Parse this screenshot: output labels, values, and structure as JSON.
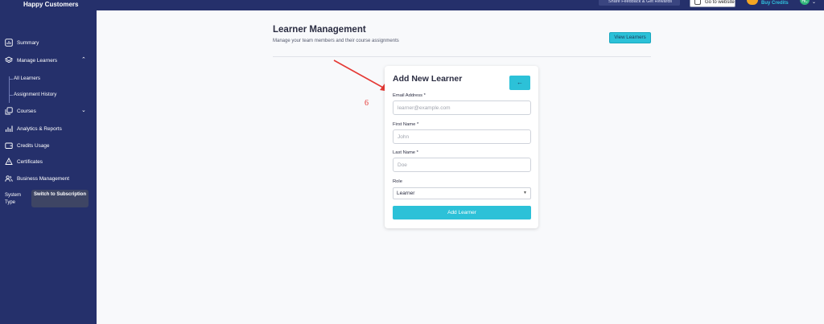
{
  "topbar": {
    "brand": "Happy Customers",
    "feedback_label": "Share Feedback & Get Rewards",
    "website_label": "Go to website",
    "buy_credits_label": "Buy Credits",
    "avatar_initials": "HC"
  },
  "sidebar": {
    "items": [
      {
        "label": "Summary",
        "icon": "chart-square-icon"
      },
      {
        "label": "Manage Learners",
        "icon": "layers-icon",
        "chevron": "⌃"
      },
      {
        "label": "All Learners"
      },
      {
        "label": "Assignment History"
      },
      {
        "label": "Courses",
        "icon": "book-copy-icon",
        "chevron": "⌄"
      },
      {
        "label": "Analytics & Reports",
        "icon": "bar-chart-icon"
      },
      {
        "label": "Credits Usage",
        "icon": "wallet-icon"
      },
      {
        "label": "Certificates",
        "icon": "certificate-icon"
      },
      {
        "label": "Business Management",
        "icon": "users-icon"
      }
    ],
    "system_type_label": "System Type",
    "switch_label": "Switch to Subscription"
  },
  "header": {
    "title": "Learner Management",
    "subtitle": "Manage your team members and their course assignments",
    "view_learners_label": "View Learners"
  },
  "annotation": {
    "step": "6",
    "color": "#e53935"
  },
  "form": {
    "title": "Add New Learner",
    "back_icon": "←",
    "email": {
      "label": "Email Address *",
      "placeholder": "learner@example.com"
    },
    "first_name": {
      "label": "First Name *",
      "placeholder": "John"
    },
    "last_name": {
      "label": "Last Name *",
      "placeholder": "Doe"
    },
    "role": {
      "label": "Role",
      "selected": "Learner"
    },
    "submit_label": "Add Learner"
  },
  "colors": {
    "sidebar_bg": "#25306b",
    "accent": "#2cc1d8",
    "buy_credits": "#30c3e0"
  }
}
